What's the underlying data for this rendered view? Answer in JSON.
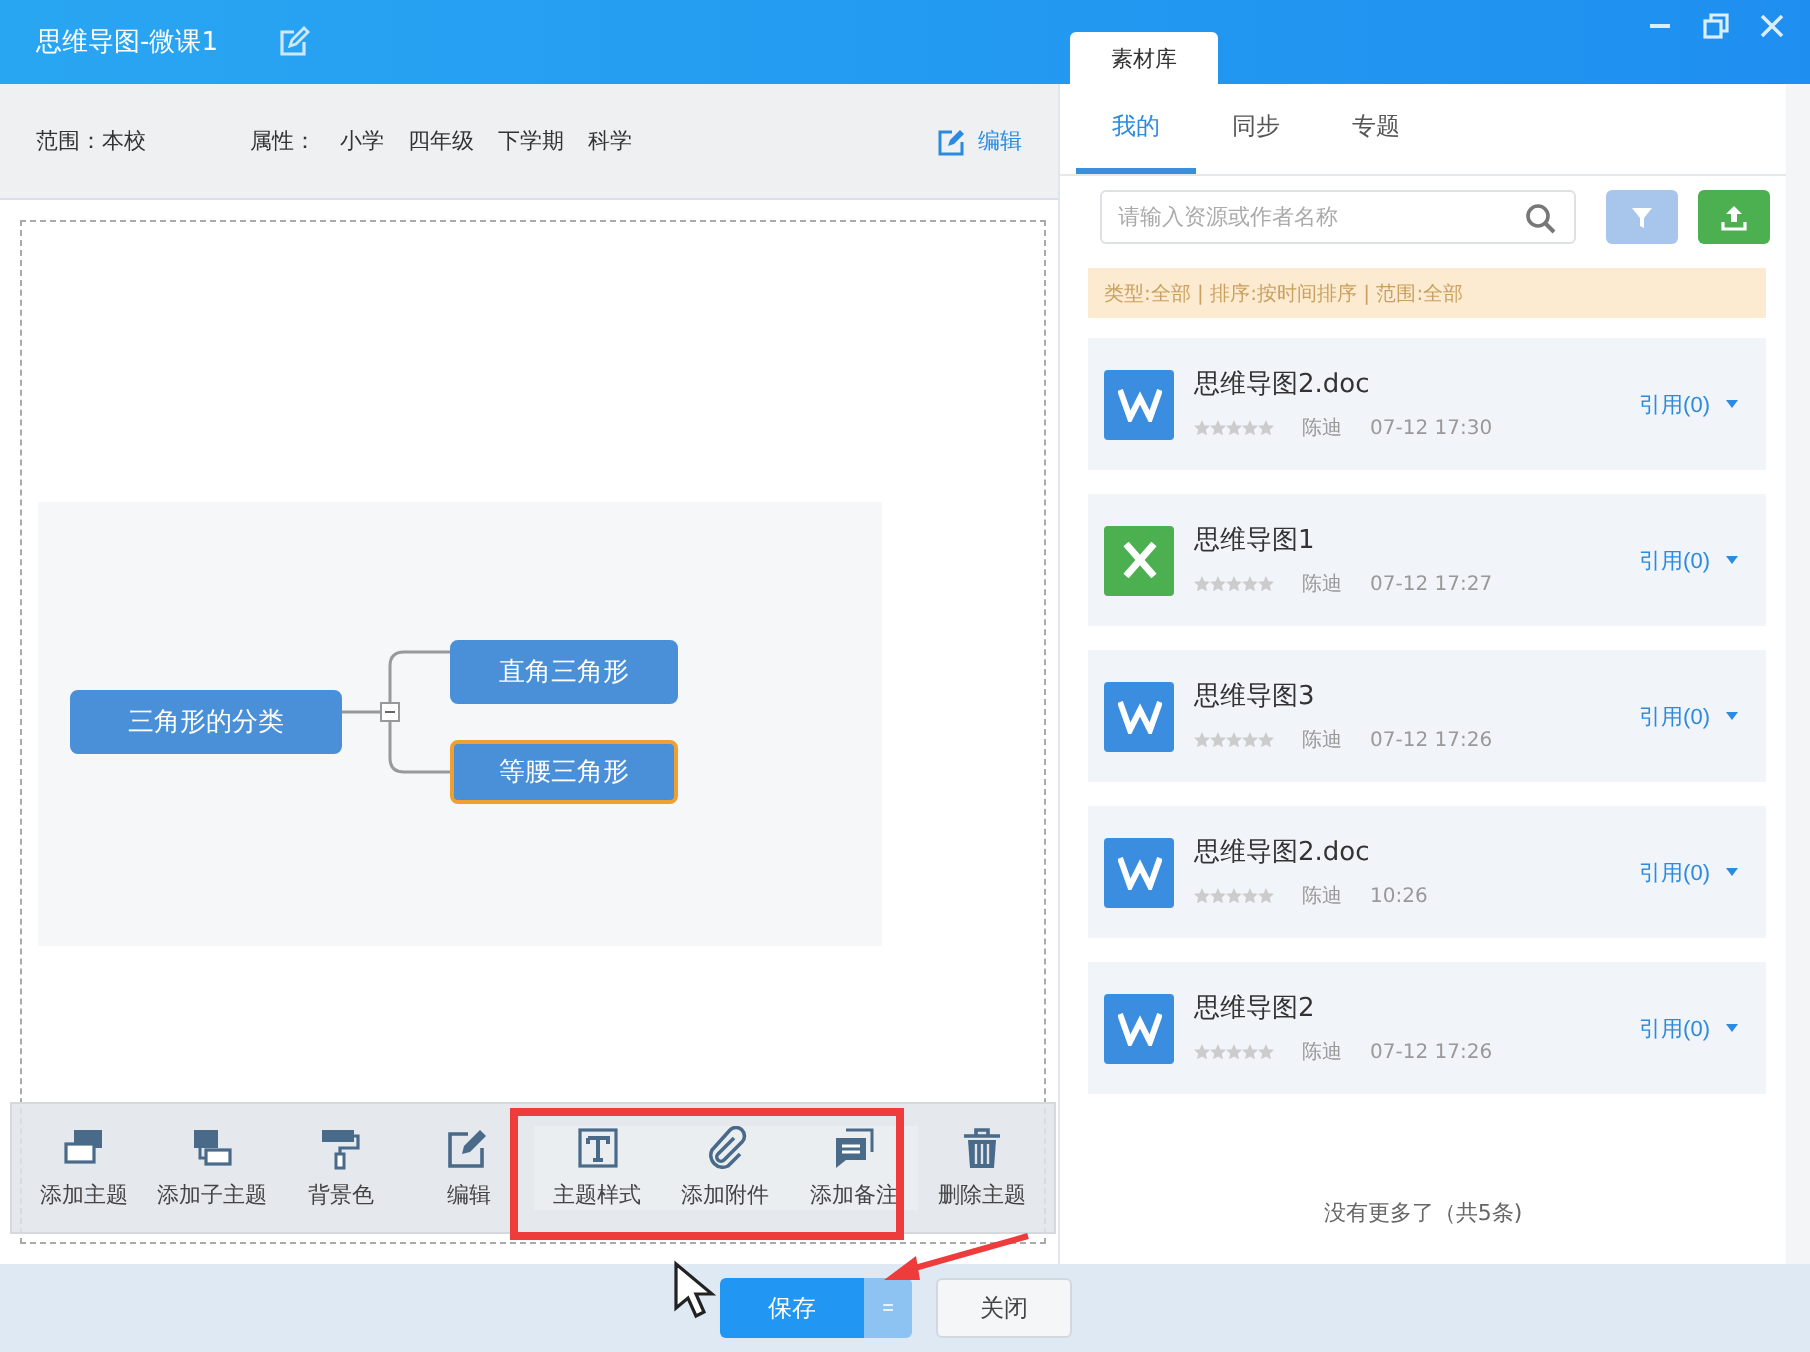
{
  "window": {
    "title": "思维导图-微课1"
  },
  "info_bar": {
    "scope": "范围：本校",
    "attr_label": "属性：",
    "attrs": [
      "小学",
      "四年级",
      "下学期",
      "科学"
    ],
    "edit": "编辑"
  },
  "mind_map": {
    "root": {
      "label": "三角形的分类",
      "expanded": true,
      "children": [
        {
          "label": "直角三角形",
          "selected": false
        },
        {
          "label": "等腰三角形",
          "selected": true
        }
      ]
    }
  },
  "toolbar": [
    {
      "kind": "add-topic",
      "label": "添加主题",
      "highlighted": false
    },
    {
      "kind": "add-subtopic",
      "label": "添加子主题",
      "highlighted": false
    },
    {
      "kind": "background",
      "label": "背景色",
      "highlighted": false
    },
    {
      "kind": "edit",
      "label": "编辑",
      "highlighted": false
    },
    {
      "kind": "style",
      "label": "主题样式",
      "highlighted": true
    },
    {
      "kind": "attach",
      "label": "添加附件",
      "highlighted": true
    },
    {
      "kind": "note",
      "label": "添加备注",
      "highlighted": true
    },
    {
      "kind": "delete",
      "label": "删除主题",
      "highlighted": false
    }
  ],
  "footer": {
    "save": "保存",
    "more": "=",
    "close": "关闭"
  },
  "library": {
    "tab": "素材库",
    "tabs": [
      {
        "label": "我的",
        "selected": true
      },
      {
        "label": "同步",
        "selected": false
      },
      {
        "label": "专题",
        "selected": false
      }
    ],
    "search": {
      "placeholder": "请输入资源或作者名称"
    },
    "filter_info": "类型:全部 | 排序:按时间排序 | 范围:全部",
    "items": [
      {
        "kind": "word",
        "name": "思维导图2.doc",
        "stars": 0,
        "author": "陈迪",
        "time": "07-12 17:30",
        "cite": "引用(0)"
      },
      {
        "kind": "excel",
        "name": "思维导图1",
        "stars": 0,
        "author": "陈迪",
        "time": "07-12 17:27",
        "cite": "引用(0)"
      },
      {
        "kind": "word",
        "name": "思维导图3",
        "stars": 0,
        "author": "陈迪",
        "time": "07-12 17:26",
        "cite": "引用(0)"
      },
      {
        "kind": "word",
        "name": "思维导图2.doc",
        "stars": 0,
        "author": "陈迪",
        "time": "10:26",
        "cite": "引用(0)"
      },
      {
        "kind": "word",
        "name": "思维导图2",
        "stars": 0,
        "author": "陈迪",
        "time": "07-12 17:26",
        "cite": "引用(0)"
      }
    ],
    "end_note": "没有更多了（共5条)"
  }
}
